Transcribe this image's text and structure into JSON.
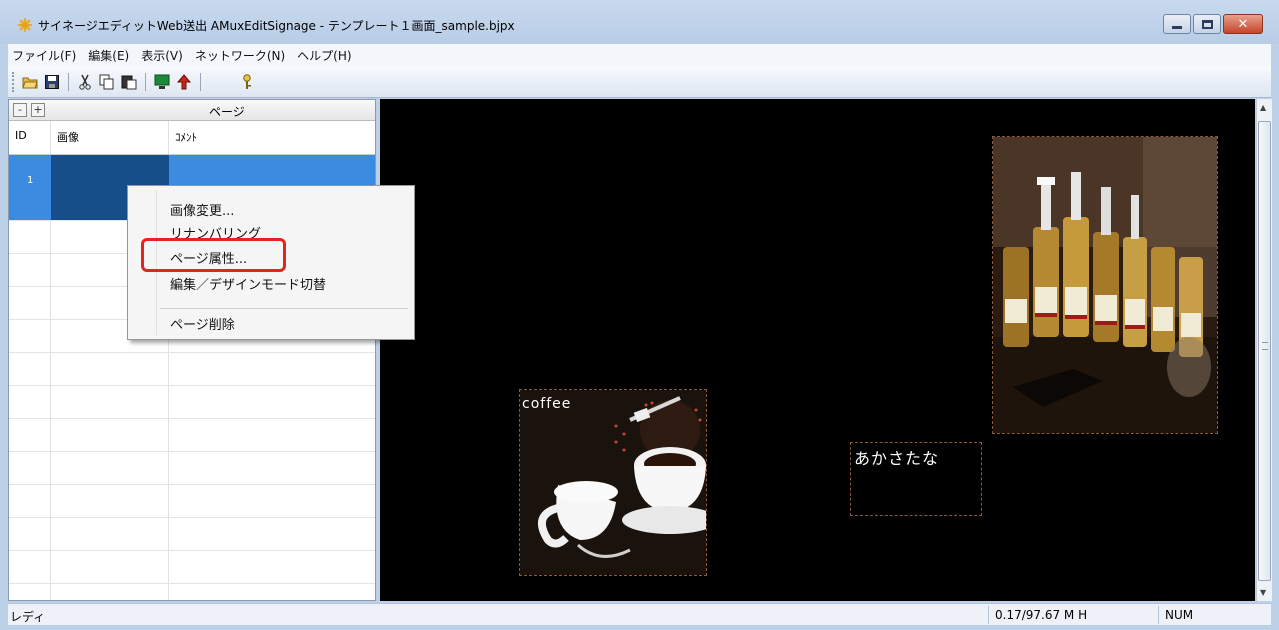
{
  "window": {
    "title": "サイネージエディットWeb送出 AMuxEditSignage - テンプレート１画面_sample.bjpx"
  },
  "menubar": {
    "items": [
      "ファイル(F)",
      "編集(E)",
      "表示(V)",
      "ネットワーク(N)",
      "ヘルプ(H)"
    ]
  },
  "toolbar": {
    "icons": [
      "open-icon",
      "save-icon",
      "cut-icon",
      "copy-icon",
      "paste-icon",
      "monitor-icon",
      "upload-arrow-icon",
      "key-icon"
    ]
  },
  "page_panel": {
    "title": "ページ",
    "collapse_label": "-",
    "expand_label": "+",
    "columns": [
      "ID",
      "画像",
      "ｺﾒﾝﾄ"
    ],
    "rows": [
      {
        "id": "1",
        "image": "",
        "comment": ""
      }
    ]
  },
  "context_menu": {
    "items": [
      "画像変更...",
      "リナンバリング",
      "ページ属性...",
      "編集／デザインモード切替",
      "ページ削除"
    ],
    "highlighted": "ページ属性..."
  },
  "canvas": {
    "coffee_label": "coffee",
    "text_object": "あかさたな"
  },
  "statusbar": {
    "left": "レディ",
    "coords": "0.17/97.67 M  H",
    "num": "NUM"
  },
  "colors": {
    "highlight": "#e8231f",
    "selection": "#3b8be0",
    "canvas_bg": "#000000"
  }
}
